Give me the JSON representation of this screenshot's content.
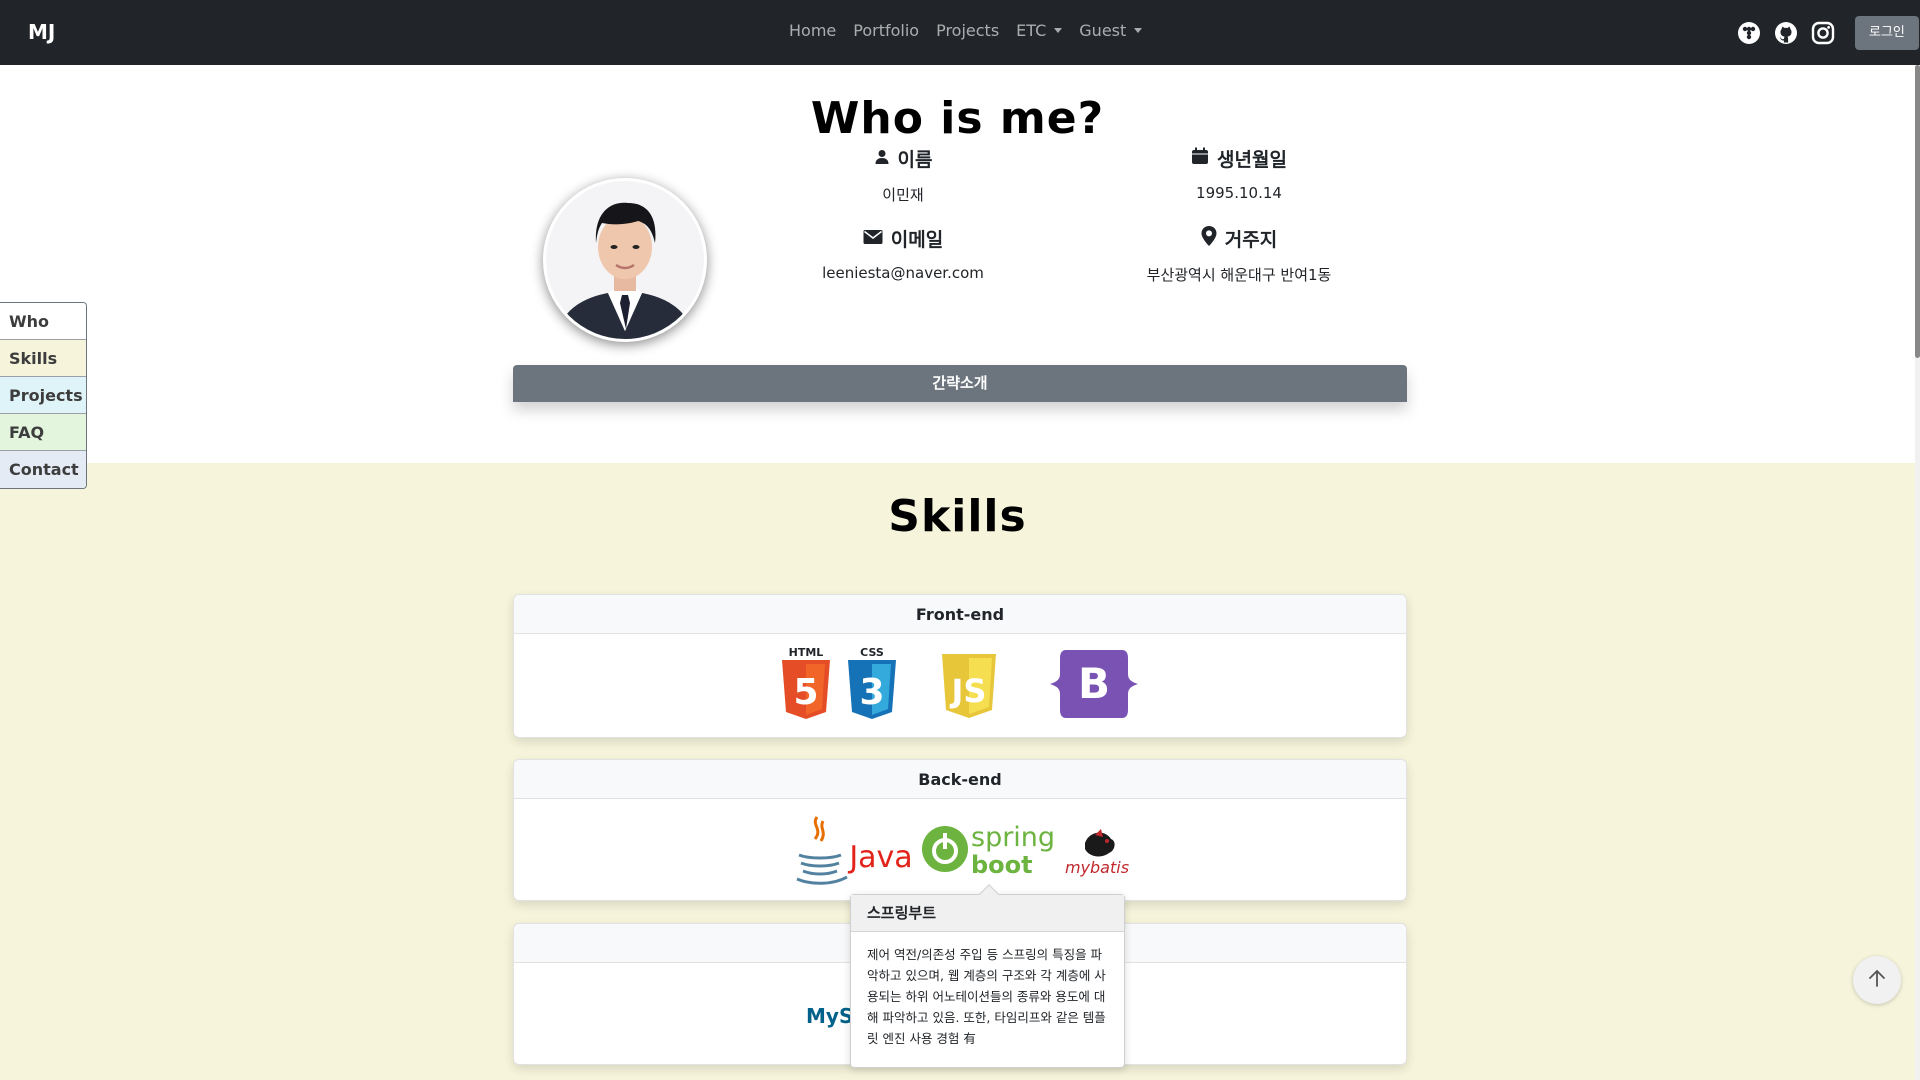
{
  "navbar": {
    "brand": "MJ",
    "links": [
      {
        "label": "Home"
      },
      {
        "label": "Portfolio"
      },
      {
        "label": "Projects"
      },
      {
        "label": "ETC",
        "dropdown": true
      },
      {
        "label": "Guest",
        "dropdown": true
      }
    ],
    "social_icons": [
      "tistory-icon",
      "github-icon",
      "instagram-icon"
    ],
    "login_label": "로그인"
  },
  "side_nav": [
    {
      "label": "Who",
      "color": "#ffffff"
    },
    {
      "label": "Skills",
      "color": "#f6f4da"
    },
    {
      "label": "Projects",
      "color": "#dff4f8"
    },
    {
      "label": "FAQ",
      "color": "#e3f5dd"
    },
    {
      "label": "Contact",
      "color": "#e4ebf4"
    }
  ],
  "who": {
    "title": "Who is me?",
    "name_label": "이름",
    "name_value": "이민재",
    "birth_label": "생년월일",
    "birth_value": "1995.10.14",
    "email_label": "이메일",
    "email_value": "leeniesta@naver.com",
    "address_label": "거주지",
    "address_value": "부산광역시 해운대구 반여1동",
    "intro_label": "간략소개"
  },
  "skills": {
    "title": "Skills",
    "frontend": {
      "header": "Front-end",
      "logos": [
        "html5-logo",
        "css3-logo",
        "javascript-logo",
        "bootstrap-logo"
      ]
    },
    "backend": {
      "header": "Back-end",
      "logos": [
        "java-logo",
        "spring-boot-logo",
        "mybatis-logo"
      ]
    },
    "database": {
      "header": "",
      "logos": [
        "mysql-logo"
      ]
    }
  },
  "logo_text": {
    "html": "HTML",
    "css": "CSS",
    "bootstrap": "B",
    "java": "Java",
    "spring": "spring",
    "boot": "boot",
    "mybatis": "mybatis",
    "mysql": "MyS"
  },
  "tooltip": {
    "title": "스프링부트",
    "body": "제어 역전/의존성 주입 등 스프링의 특징을 파악하고 있으며, 웹 계층의 구조와 각 계층에 사용되는 하위 어노테이션들의 종류와 용도에 대해 파악하고 있음. 또한, 타임리프와 같은 템플릿 엔진 사용 경험 有"
  },
  "colors": {
    "navbar": "#212529",
    "skills_bg": "#f6f4da",
    "intro_bar": "#6c757d",
    "html5": "#e44d26",
    "css3": "#1572b6",
    "js": "#f0db4f",
    "bootstrap": "#7952b3",
    "java": "#e76f00",
    "spring": "#6db33f",
    "mybatis": "#c0282d"
  }
}
